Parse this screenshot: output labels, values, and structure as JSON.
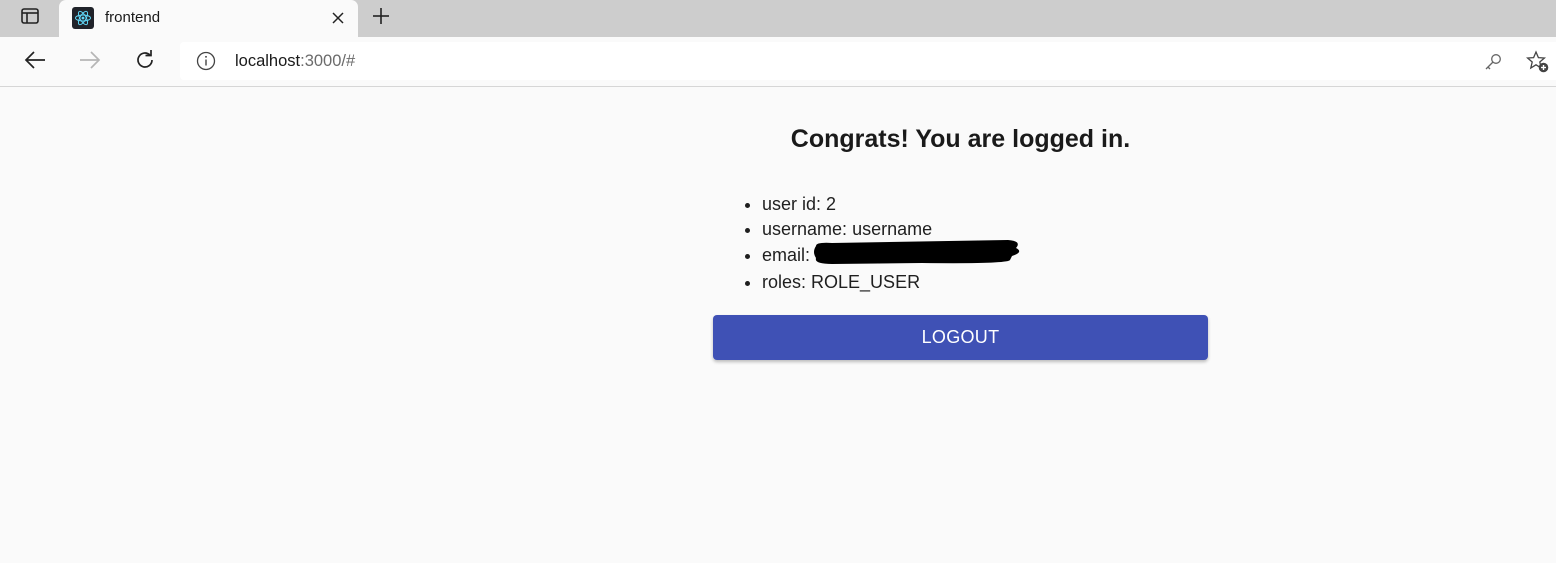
{
  "browser": {
    "tab": {
      "title": "frontend",
      "favicon": "react-icon"
    },
    "address": {
      "host": "localhost",
      "rest": ":3000/#"
    },
    "icons": {
      "tab_actions": "tab-actions-icon",
      "close": "close-icon",
      "new_tab": "plus-icon",
      "back": "back-arrow-icon",
      "forward": "forward-arrow-icon",
      "refresh": "refresh-icon",
      "site_info": "info-icon",
      "password": "key-icon",
      "favorites": "add-favorite-icon"
    }
  },
  "page": {
    "heading": "Congrats! You are logged in.",
    "details": [
      {
        "label": "user id:",
        "value": "2"
      },
      {
        "label": "username:",
        "value": "username"
      },
      {
        "label": "email:",
        "value": ""
      },
      {
        "label": "roles:",
        "value": "ROLE_USER"
      }
    ],
    "logout_label": "LOGOUT"
  },
  "colors": {
    "button_bg": "#3f51b5",
    "page_bg": "#fafafa",
    "tabstrip_bg": "#cdcdcd"
  }
}
